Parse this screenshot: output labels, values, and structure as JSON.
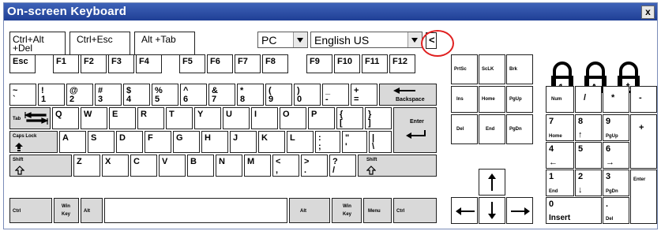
{
  "window": {
    "title": "On-screen Keyboard",
    "close_label": "x"
  },
  "toolbar": {
    "ctrl_alt_del": [
      "Ctrl+Alt",
      "+Del"
    ],
    "ctrl_esc": "Ctrl+Esc",
    "alt_tab": "Alt +Tab",
    "layout_select": "PC",
    "language_select": "English US",
    "collapse_button": "<"
  },
  "locks": [
    "1",
    "A",
    "⇟"
  ],
  "keys": {
    "esc": "Esc",
    "f": [
      "F1",
      "F2",
      "F3",
      "F4",
      "F5",
      "F6",
      "F7",
      "F8",
      "F9",
      "F10",
      "F11",
      "F12"
    ],
    "number_row": [
      [
        "~",
        "`"
      ],
      [
        "!",
        "1"
      ],
      [
        "@",
        "2"
      ],
      [
        "#",
        "3"
      ],
      [
        "$",
        "4"
      ],
      [
        "%",
        "5"
      ],
      [
        "^",
        "6"
      ],
      [
        "&",
        "7"
      ],
      [
        "*",
        "8"
      ],
      [
        "(",
        "9"
      ],
      [
        ")",
        "0"
      ],
      [
        "_",
        "-"
      ],
      [
        "+",
        "="
      ]
    ],
    "backspace": "Backspace",
    "tab": "Tab",
    "q_row": [
      "Q",
      "W",
      "E",
      "R",
      "T",
      "Y",
      "U",
      "I",
      "O",
      "P"
    ],
    "q_row_extra": [
      [
        "{",
        "["
      ],
      [
        "}",
        "]"
      ]
    ],
    "enter": "Enter",
    "caps_lock": "Caps Lock",
    "a_row": [
      "A",
      "S",
      "D",
      "F",
      "G",
      "H",
      "J",
      "K",
      "L"
    ],
    "a_row_extra": [
      [
        ":",
        ";"
      ],
      [
        "\"",
        "'"
      ],
      [
        "|",
        "\\"
      ]
    ],
    "shift": "Shift",
    "z_row": [
      "Z",
      "X",
      "C",
      "V",
      "B",
      "N",
      "M"
    ],
    "z_row_extra": [
      [
        "<",
        ","
      ],
      [
        ">",
        "."
      ],
      [
        "?",
        "/"
      ]
    ],
    "ctrl": "Ctrl",
    "win_key": [
      "Win",
      "Key"
    ],
    "alt": "Alt",
    "menu": "Menu",
    "nav": {
      "prtsc": "PrtSc",
      "scrlk": "ScLK",
      "brk": "Brk",
      "ins": "Ins",
      "home": "Home",
      "pgup": "PgUp",
      "del": "Del",
      "end": "End",
      "pgdn": "PgDn"
    },
    "numpad": {
      "num": "Num",
      "slash": "/",
      "star": "*",
      "minus": "-",
      "plus": "+",
      "enter": "Enter",
      "n7": [
        "7",
        "Home"
      ],
      "n8": [
        "8",
        "↑"
      ],
      "n9": [
        "9",
        "PgUp"
      ],
      "n4": [
        "4",
        "←"
      ],
      "n5": "5",
      "n6": [
        "6",
        "→"
      ],
      "n1": [
        "1",
        "End"
      ],
      "n2": [
        "2",
        "↓"
      ],
      "n3": [
        "3",
        "PgDn"
      ],
      "n0": [
        "0",
        "Insert"
      ],
      "dot": [
        ".",
        "Del"
      ]
    }
  }
}
